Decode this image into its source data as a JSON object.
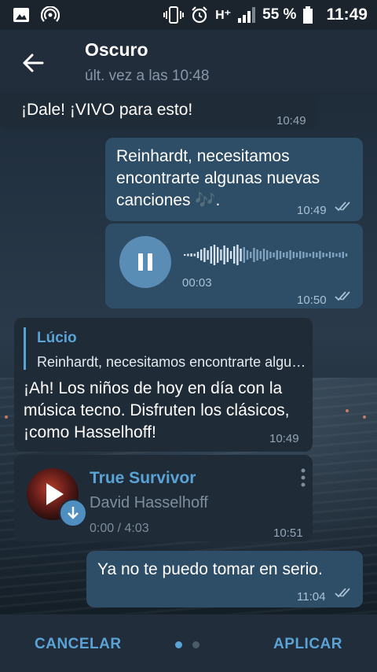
{
  "status_bar": {
    "network_type": "H⁺",
    "battery_percent": "55 %",
    "clock": "11:49",
    "icons": [
      "gallery-icon",
      "hotspot-icon",
      "vibrate-icon",
      "alarm-icon",
      "signal-icon",
      "battery-icon"
    ]
  },
  "header": {
    "title": "Oscuro",
    "subtitle": "últ. vez a las 10:48",
    "back_icon": "arrow-left-icon"
  },
  "messages": [
    {
      "direction": "in",
      "text": "¡Dale! ¡VIVO para esto!",
      "time": "10:49"
    },
    {
      "direction": "out",
      "text": "Reinhardt, necesitamos encontrarte algunas nuevas canciones 🎶.",
      "time": "10:49",
      "read": true
    },
    {
      "direction": "out",
      "type": "voice",
      "duration": "00:03",
      "time": "10:50",
      "read": true,
      "playing": true
    },
    {
      "direction": "in",
      "reply_to": {
        "name": "Lúcio",
        "text": "Reinhardt, necesitamos encontrarte algunas nuevas canciones"
      },
      "text": "¡Ah! Los niños de hoy en día con la música tecno. Disfruten los clásicos, ¡como Hasselhoff!",
      "time": "10:49"
    },
    {
      "direction": "in",
      "type": "audio",
      "title": "True Survivor",
      "artist": "David Hasselhoff",
      "progress": "0:00 / 4:03",
      "time": "10:51"
    },
    {
      "direction": "out",
      "text": "Ya no te puedo tomar en serio.",
      "time": "11:04",
      "read": true
    }
  ],
  "bottom_bar": {
    "cancel_label": "CANCELAR",
    "apply_label": "APLICAR",
    "page_count": 2,
    "active_page": 1
  },
  "colors": {
    "accent": "#5aa3d6",
    "incoming_bubble": "#1f2b37",
    "outgoing_bubble": "#2e4d66",
    "header": "#212d3b"
  }
}
